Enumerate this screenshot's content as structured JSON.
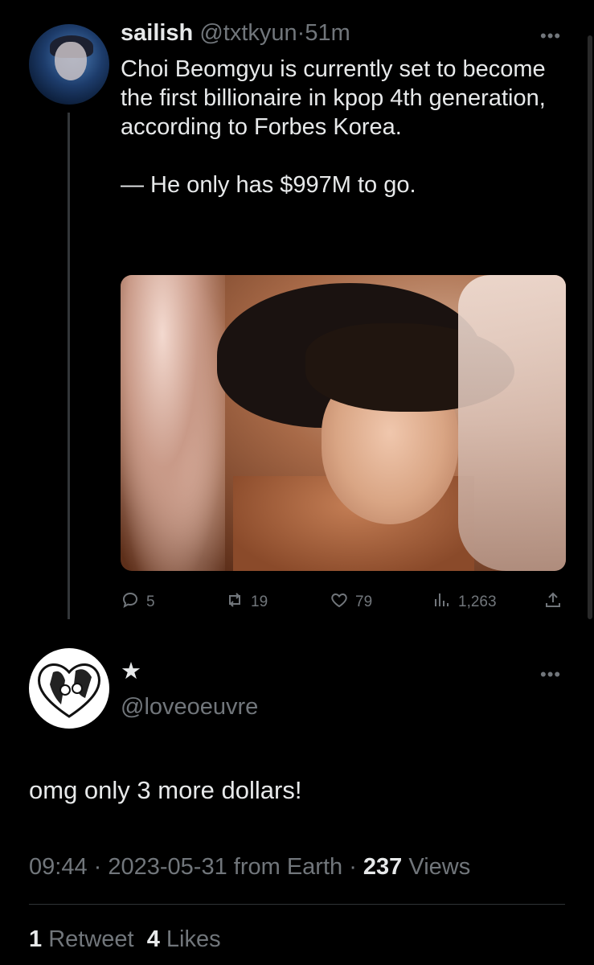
{
  "tweet": {
    "author_name": "sailish",
    "author_handle": "@txtkyun",
    "time_ago": "51m",
    "separator": "·",
    "text_paragraph_1": "Choi Beomgyu is currently set to become the first billionaire in kpop 4th generation, according to Forbes Korea.",
    "text_paragraph_2": "— He only has $997M to go.",
    "reply_count": "5",
    "retweet_count": "19",
    "like_count": "79",
    "view_count": "1,263"
  },
  "reply": {
    "author_name": "★",
    "author_handle": "@loveoeuvre",
    "text": "omg only 3 more dollars!",
    "time": "09:44",
    "date": "2023-05-31",
    "source": "from Earth",
    "views_count": "237",
    "views_label": "Views",
    "retweets_count": "1",
    "retweets_label": "Retweet",
    "likes_count": "4",
    "likes_label": "Likes"
  },
  "icons": {
    "more": "more-icon",
    "reply": "reply-icon",
    "retweet": "retweet-icon",
    "like": "heart-icon",
    "views": "views-icon",
    "share": "share-icon"
  },
  "colors": {
    "background": "#000000",
    "text_primary": "#e7e9ea",
    "text_secondary": "#71767b",
    "divider": "#2f3336"
  }
}
